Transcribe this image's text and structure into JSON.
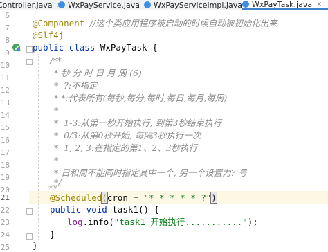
{
  "tabs": [
    {
      "label": "Controller.java"
    },
    {
      "label": "WxPayService.java"
    },
    {
      "label": "WxPayServiceImpl.java"
    },
    {
      "label": "WxPayTask.java",
      "active": true
    }
  ],
  "close_glyph": "×",
  "line_numbers": [
    "6",
    "7",
    "8",
    "9",
    "10",
    "11",
    "12",
    "13",
    "14",
    "15",
    "16",
    "17",
    "18",
    "19",
    "20",
    "21",
    "22",
    "23",
    "24",
    "25"
  ],
  "code": {
    "l7_ann": "@Component",
    "l7_comment": "//这个类应用程序被启动的时候自动被初始化出来",
    "l8_ann": "@Slf4j",
    "l9_kw": "public class",
    "l9_rest": " WxPayTask {",
    "l10": "/**",
    "l11": "* 秒 分 时 日 月 周 (6)",
    "l12": "*  ?:不指定",
    "l13": "* *:代表所有(每秒,每分,每时,每日,每月,每周)",
    "l14": "*",
    "l15": "*  1-3:从第一秒开始执行, 到第3秒结束执行",
    "l16": "*  0/3:从第0秒开始, 每隔3秒执行一次",
    "l17": "*  1, 2, 3:在指定的第1、2、3秒执行",
    "l18": "*",
    "l19": "* 日和周不能同时指定其中一个, 另一个设置为? 号",
    "l20": "*/",
    "l21_ann": "@Scheduled",
    "l21_open": "(",
    "l21_mid": "cron = ",
    "l21_str": "\"* * * * * ?\"",
    "l21_close": ")",
    "l22_kw": "public void",
    "l22_rest": " task1() {",
    "l23_fld": "log",
    "l23_mid": ".info(",
    "l23_str": "\"task1 开始执行...........\"",
    "l23_end": ");",
    "l24": "}",
    "l25": "}"
  },
  "icons": {
    "run": "bean-run-icon",
    "bulb": "intention-bulb-icon"
  },
  "colors": {
    "keyword": "#0033b3",
    "annotation": "#9e880d",
    "string": "#067d17",
    "comment": "#8c8c8c",
    "field": "#871094",
    "highlight": "#fcf8e4"
  }
}
